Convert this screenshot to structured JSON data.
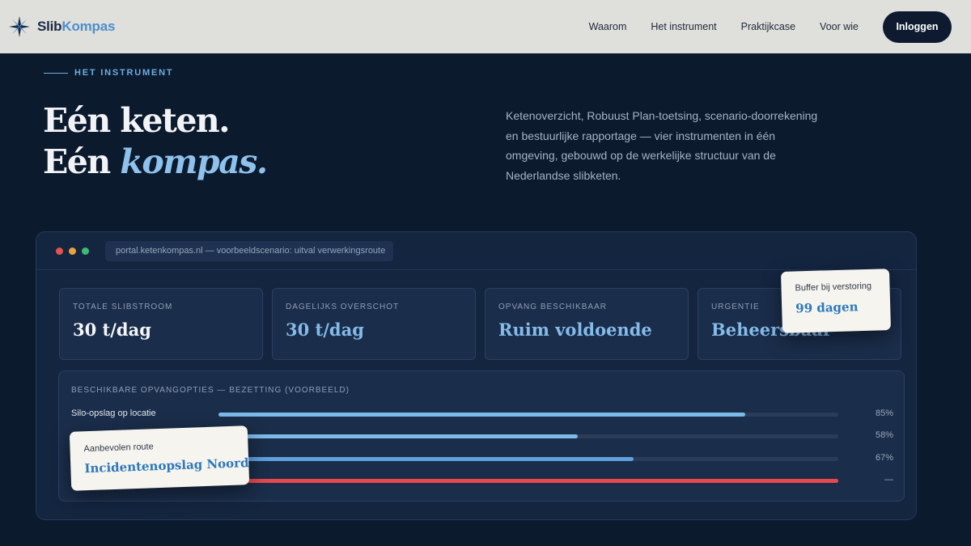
{
  "brand": {
    "name_part1": "Slib",
    "name_part2": "Kompas",
    "icon": "compass-star-icon",
    "colors": {
      "dark": "#1b2a44",
      "accent": "#4b8fcd"
    }
  },
  "nav": {
    "links": [
      "Waarom",
      "Het instrument",
      "Praktijkcase",
      "Voor wie"
    ],
    "login_label": "Inloggen"
  },
  "hero": {
    "eyebrow": "HET INSTRUMENT",
    "headline_line1": "Eén keten.",
    "headline_line2_prefix": "Eén ",
    "headline_line2_emphasis": "kompas.",
    "intro": "Ketenoverzicht, Robuust Plan-toetsing, scenario-doorrekening en bestuurlijke rapportage — vier instrumenten in één omgeving, gebouwd op de werkelijke structuur van de Nederlandse slibketen."
  },
  "window": {
    "url": "portal.ketenkompas.nl — voorbeeldscenario: uitval verwerkingsroute",
    "traffic_colors": [
      "#e5534b",
      "#e8a33d",
      "#3dbb75"
    ]
  },
  "stats": [
    {
      "label": "TOTALE SLIBSTROOM",
      "value": "30 t/dag"
    },
    {
      "label": "DAGELIJKS OVERSCHOT",
      "value": "30 t/dag"
    },
    {
      "label": "OPVANG BESCHIKBAAR",
      "value": "Ruim voldoende"
    },
    {
      "label": "URGENTIE",
      "value": "Beheersbaar"
    }
  ],
  "capacity": {
    "title": "BESCHIKBARE OPVANGOPTIES — BEZETTING (VOORBEELD)",
    "rows": [
      {
        "label": "Silo-opslag op locatie",
        "value": "85%",
        "fraction": 0.85,
        "color": "#7bbbe8"
      },
      {
        "label": "",
        "value": "58%",
        "fraction": 0.58,
        "color": "#7bbbe8"
      },
      {
        "label": "",
        "value": "67%",
        "fraction": 0.67,
        "color": "#5e9fdc"
      },
      {
        "label": "",
        "value": "—",
        "fraction": 1.0,
        "color": "#e5484d"
      }
    ]
  },
  "callouts": {
    "buffer": {
      "label": "Buffer bij verstoring",
      "value": "99 dagen"
    },
    "route": {
      "label": "Aanbevolen route",
      "value": "Incidentenopslag Noord"
    }
  }
}
